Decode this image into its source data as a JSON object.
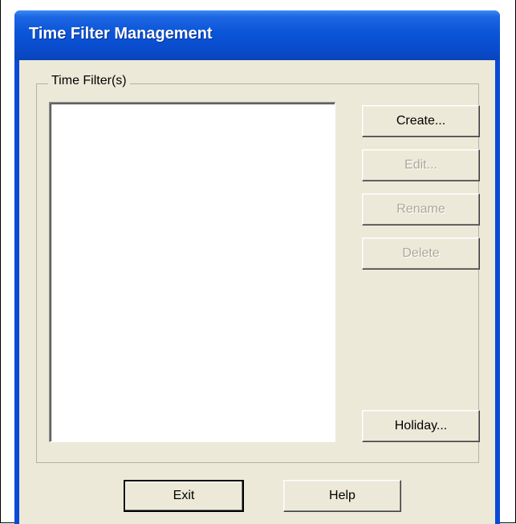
{
  "window": {
    "title": "Time Filter Management"
  },
  "group": {
    "label": "Time Filter(s)",
    "items": []
  },
  "buttons": {
    "create": "Create...",
    "edit": "Edit...",
    "rename": "Rename",
    "delete": "Delete",
    "holiday": "Holiday...",
    "exit": "Exit",
    "help": "Help"
  },
  "colors": {
    "titlebar": "#0a55d8",
    "face": "#ece9d8",
    "disabled_text": "#aca899"
  }
}
